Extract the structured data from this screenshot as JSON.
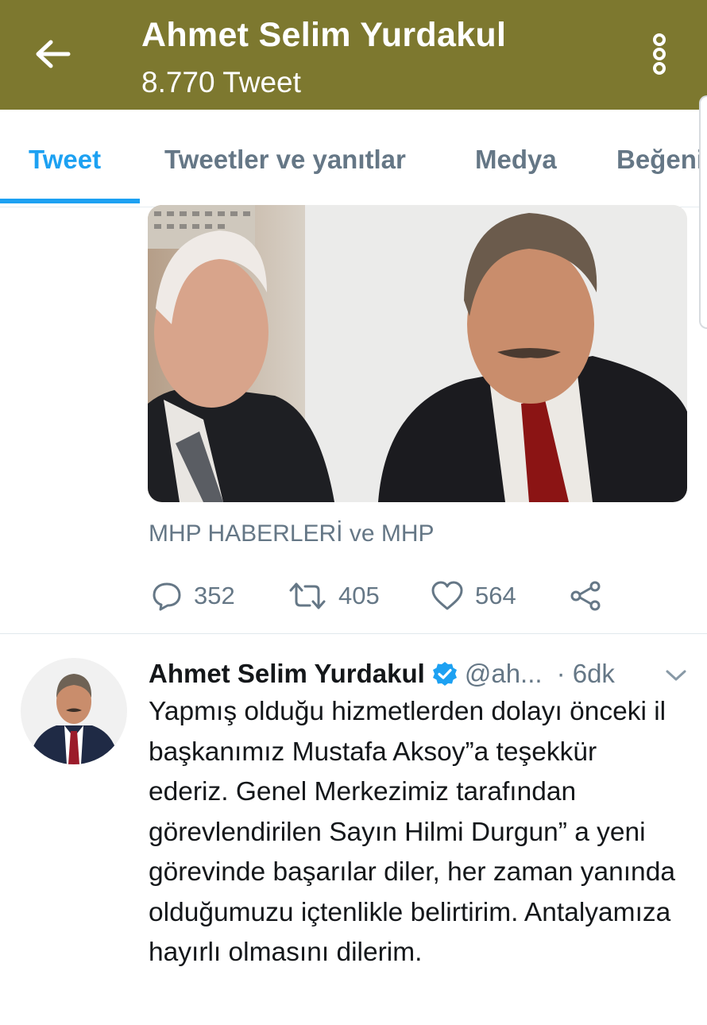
{
  "header": {
    "title": "Ahmet Selim Yurdakul",
    "subtitle": "8.770 Tweet",
    "back_icon": "arrow-left-icon",
    "more_icon": "more-vertical-icon",
    "background_color": "#7d782f"
  },
  "tabs": [
    {
      "label": "Tweet",
      "active": true
    },
    {
      "label": "Tweetler ve yanıtlar",
      "active": false
    },
    {
      "label": "Medya",
      "active": false
    },
    {
      "label": "Beğeni",
      "active": false
    }
  ],
  "accent_color": "#1da1f2",
  "previous_tweet": {
    "source": "MHP HABERLERİ ve MHP",
    "actions": {
      "replies": "352",
      "retweets": "405",
      "likes": "564"
    },
    "icons": [
      "reply-icon",
      "retweet-icon",
      "like-icon",
      "share-icon"
    ]
  },
  "tweet": {
    "name": "Ahmet Selim Yurdakul",
    "verified": true,
    "handle": "@ah...",
    "time": "· 6dk",
    "text": "Yapmış olduğu hizmetlerden dolayı önceki il başkanımız Mustafa Aksoy”a teşekkür ederiz. Genel Merkezimiz tarafından görevlendirilen Sayın Hilmi Durgun” a yeni görevinde başarılar diler, her zaman yanında olduğumuzu içtenlikle belirtirim. Antalyamıza hayırlı olmasını dilerim."
  }
}
